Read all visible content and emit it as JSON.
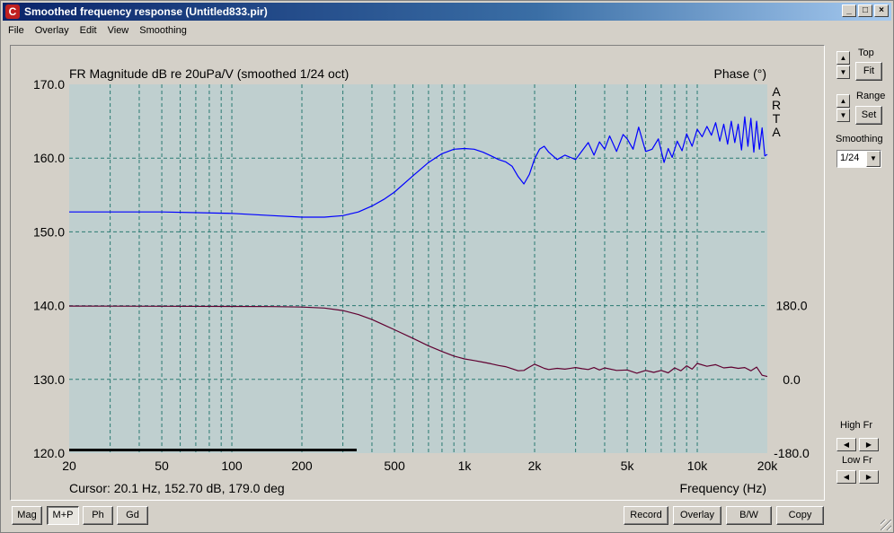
{
  "window": {
    "title": "Smoothed frequency response (Untitled833.pir)",
    "icon_letter": "C",
    "min": "_",
    "max": "□",
    "close": "×"
  },
  "menu": [
    "File",
    "Overlay",
    "Edit",
    "View",
    "Smoothing"
  ],
  "right_panel": {
    "top_label": "Top",
    "fit_label": "Fit",
    "range_label": "Range",
    "set_label": "Set",
    "smoothing_label": "Smoothing",
    "smoothing_value": "1/24",
    "high_fr_label": "High Fr",
    "low_fr_label": "Low Fr"
  },
  "bottom_buttons": {
    "mag": "Mag",
    "mp": "M+P",
    "ph": "Ph",
    "gd": "Gd",
    "record": "Record",
    "overlay": "Overlay",
    "bw": "B/W",
    "copy": "Copy"
  },
  "chart_data": {
    "type": "line",
    "title": "FR Magnitude dB re 20uPa/V (smoothed 1/24 oct)",
    "right_title": "Phase (°)",
    "watermark": [
      "A",
      "R",
      "T",
      "A"
    ],
    "xlabel": "Frequency (Hz)",
    "cursor_text": "Cursor: 20.1 Hz, 152.70 dB, 179.0 deg",
    "xscale": "log",
    "xlim": [
      20,
      20000
    ],
    "ylim": [
      120,
      170
    ],
    "y2lim": [
      -180,
      180
    ],
    "x_tick_labels": [
      "20",
      "50",
      "100",
      "200",
      "500",
      "1k",
      "2k",
      "5k",
      "10k",
      "20k"
    ],
    "x_tick_values": [
      20,
      50,
      100,
      200,
      500,
      1000,
      2000,
      5000,
      10000,
      20000
    ],
    "y_tick_labels": [
      "170.0",
      "160.0",
      "150.0",
      "140.0",
      "130.0",
      "120.0"
    ],
    "y2_tick_labels": [
      "180.0",
      "0.0",
      "-180.0"
    ],
    "grid": true,
    "colors": {
      "background": "#bfcfcf",
      "grid": "#2a7a72",
      "magnitude": "#0000ff",
      "phase": "#600030",
      "cursor_bar": "#000000"
    },
    "series": [
      {
        "name": "magnitude",
        "axis": "left",
        "x": [
          20,
          50,
          100,
          150,
          200,
          250,
          300,
          350,
          400,
          450,
          500,
          600,
          700,
          800,
          900,
          1000,
          1100,
          1200,
          1300,
          1400,
          1500,
          1600,
          1700,
          1800,
          1900,
          2000,
          2100,
          2200,
          2300,
          2500,
          2700,
          3000,
          3200,
          3400,
          3600,
          3800,
          4000,
          4200,
          4500,
          4800,
          5000,
          5300,
          5600,
          6000,
          6400,
          6800,
          7200,
          7500,
          7800,
          8200,
          8600,
          9000,
          9500,
          10000,
          10500,
          11000,
          11500,
          12000,
          12500,
          13000,
          13500,
          14000,
          14500,
          15000,
          15500,
          16000,
          16500,
          17000,
          17500,
          18000,
          18500,
          19000,
          19500,
          20000
        ],
        "values": [
          152.7,
          152.7,
          152.5,
          152.2,
          152.0,
          152.0,
          152.2,
          152.7,
          153.5,
          154.4,
          155.4,
          157.6,
          159.4,
          160.6,
          161.2,
          161.3,
          161.2,
          160.8,
          160.3,
          159.8,
          159.5,
          158.9,
          157.5,
          156.5,
          157.8,
          159.9,
          161.2,
          161.6,
          160.8,
          159.8,
          160.4,
          159.8,
          161.0,
          162.1,
          160.4,
          162.2,
          161.2,
          163.0,
          160.9,
          163.2,
          162.6,
          161.2,
          164.2,
          160.9,
          161.2,
          162.6,
          159.4,
          161.3,
          160.1,
          162.3,
          161.0,
          163.3,
          161.6,
          163.9,
          162.9,
          164.3,
          163.1,
          164.8,
          162.3,
          164.6,
          161.9,
          165.0,
          162.1,
          164.6,
          161.1,
          165.6,
          161.6,
          165.4,
          160.8,
          165.0,
          161.2,
          164.1,
          160.3,
          160.5
        ]
      },
      {
        "name": "phase",
        "axis": "right",
        "x": [
          20,
          50,
          100,
          150,
          200,
          250,
          300,
          350,
          400,
          450,
          500,
          600,
          700,
          800,
          900,
          1000,
          1100,
          1200,
          1300,
          1400,
          1500,
          1600,
          1700,
          1800,
          1900,
          2000,
          2100,
          2200,
          2300,
          2500,
          2700,
          3000,
          3200,
          3400,
          3600,
          3800,
          4000,
          4500,
          5000,
          5500,
          6000,
          6500,
          7000,
          7500,
          8000,
          8500,
          9000,
          9500,
          10000,
          11000,
          12000,
          13000,
          14000,
          15000,
          16000,
          17000,
          18000,
          19000,
          20000
        ],
        "values": [
          179.0,
          178.5,
          178.0,
          177.5,
          176.5,
          174.0,
          168.0,
          158.0,
          146.0,
          133.0,
          121.0,
          100.0,
          82.0,
          68.0,
          57.0,
          50.0,
          46.0,
          42.0,
          38.0,
          34.0,
          31.0,
          26.0,
          21.0,
          22.0,
          30.0,
          37.0,
          32.0,
          27.0,
          24.0,
          27.0,
          25.0,
          29.0,
          26.0,
          24.0,
          29.0,
          23.0,
          28.0,
          22.0,
          23.0,
          15.0,
          22.0,
          17.0,
          22.0,
          16.0,
          28.0,
          21.0,
          33.0,
          25.0,
          39.0,
          32.0,
          36.0,
          28.0,
          30.0,
          27.0,
          29.0,
          21.0,
          30.0,
          10.0,
          7.0
        ]
      }
    ]
  }
}
